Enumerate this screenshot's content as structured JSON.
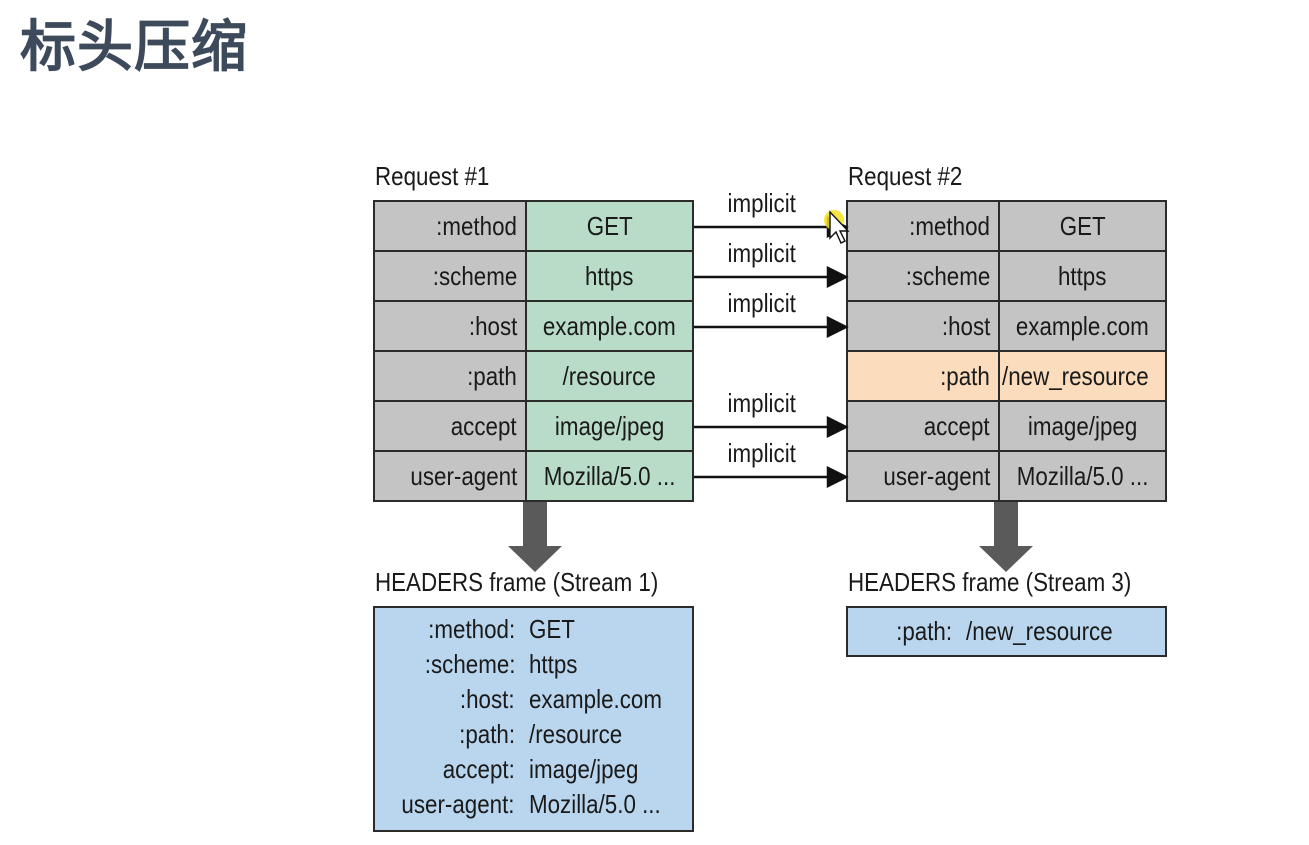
{
  "title": "标头压缩",
  "request1": {
    "label": "Request #1",
    "rows": [
      {
        "name": ":method",
        "value": "GET"
      },
      {
        "name": ":scheme",
        "value": "https"
      },
      {
        "name": ":host",
        "value": "example.com"
      },
      {
        "name": ":path",
        "value": "/resource"
      },
      {
        "name": "accept",
        "value": "image/jpeg"
      },
      {
        "name": "user-agent",
        "value": "Mozilla/5.0 ..."
      }
    ]
  },
  "request2": {
    "label": "Request #2",
    "rows": [
      {
        "name": ":method",
        "value": "GET"
      },
      {
        "name": ":scheme",
        "value": "https"
      },
      {
        "name": ":host",
        "value": "example.com"
      },
      {
        "name": ":path",
        "value": "/new_resource"
      },
      {
        "name": "accept",
        "value": "image/jpeg"
      },
      {
        "name": "user-agent",
        "value": "Mozilla/5.0 ..."
      }
    ]
  },
  "arrow_label": "implicit",
  "frame1": {
    "label": "HEADERS frame (Stream 1)",
    "rows": [
      {
        "name": ":method:",
        "value": "GET"
      },
      {
        "name": ":scheme:",
        "value": "https"
      },
      {
        "name": ":host:",
        "value": "example.com"
      },
      {
        "name": ":path:",
        "value": "/resource"
      },
      {
        "name": "accept:",
        "value": "image/jpeg"
      },
      {
        "name": "user-agent:",
        "value": "Mozilla/5.0 ..."
      }
    ]
  },
  "frame2": {
    "label": "HEADERS frame (Stream 3)",
    "rows": [
      {
        "name": ":path:",
        "value": "/new_resource"
      }
    ]
  },
  "colors": {
    "request1_value_bg": "#b9dcc8",
    "name_bg": "#c4c4c4",
    "changed_bg": "#fbdcbc",
    "frame_bg": "#b9d6ee",
    "title_color": "#3d4a5c",
    "down_arrow": "#5a5a5a"
  }
}
